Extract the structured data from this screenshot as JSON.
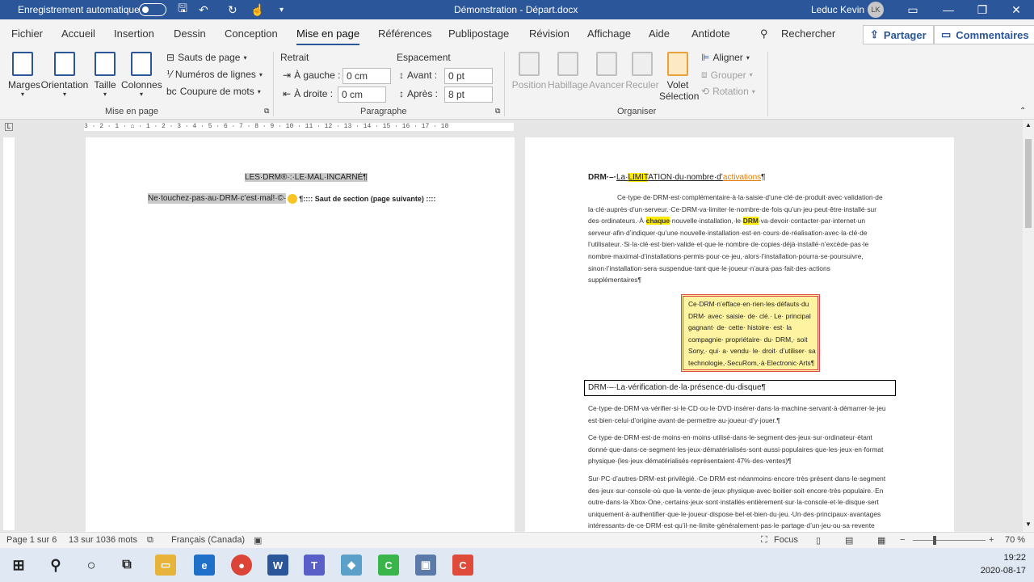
{
  "titlebar": {
    "autosave": "Enregistrement automatique",
    "doc_title": "Démonstration - Départ.docx",
    "user_name": "Leduc Kevin",
    "user_initials": "LK"
  },
  "tabs": [
    "Fichier",
    "Accueil",
    "Insertion",
    "Dessin",
    "Conception",
    "Mise en page",
    "Références",
    "Publipostage",
    "Révision",
    "Affichage",
    "Aide",
    "Antidote"
  ],
  "active_tab": "Mise en page",
  "search_label": "Rechercher",
  "share_label": "Partager",
  "comments_label": "Commentaires",
  "ribbon": {
    "margins": "Marges",
    "orientation": "Orientation",
    "size": "Taille",
    "columns": "Colonnes",
    "breaks": "Sauts de page",
    "line_numbers": "Numéros de lignes",
    "hyphenation": "Coupure de mots",
    "group_page_setup": "Mise en page",
    "indent_title": "Retrait",
    "left_label": "À gauche :",
    "left_value": "0 cm",
    "right_label": "À droite :",
    "right_value": "0 cm",
    "spacing_title": "Espacement",
    "before_label": "Avant :",
    "before_value": "0 pt",
    "after_label": "Après :",
    "after_value": "8 pt",
    "group_paragraph": "Paragraphe",
    "position": "Position",
    "wrap": "Habillage",
    "forward": "Avancer",
    "backward": "Reculer",
    "selection_pane_1": "Volet",
    "selection_pane_2": "Sélection",
    "align": "Aligner",
    "group": "Grouper",
    "rotate": "Rotation",
    "group_arrange": "Organiser"
  },
  "ruler_text": "3 · 2 · 1 · ⌂ · 1 · 2 · 3 · 4 · 5 · 6 · 7 · 8 · 9 · 10 · 11 · 12 · 13 · 14 · 15 · 16 · 17 · 18",
  "page1": {
    "title": "LES·DRM®·:·LE·MAL·INCARNÉ¶",
    "line2": "Ne·touchez·pas·au·DRM·c’est·mal!·©·",
    "section_break": "¶:::: Saut de section (page suivante) ::::"
  },
  "page2": {
    "heading_prefix": "DRM·–·",
    "heading_la": "La·",
    "heading_limit": "LIMIT",
    "heading_mid": "ATION·du·nombre·d’",
    "heading_activations": "activations",
    "heading_end": "¶",
    "para1": [
      "Ce·type·de·DRM·est·complémentaire·à·la·saisie·d’une·clé·de·produit·avec·validation·de",
      "la·clé·auprès·d’un·serveur.·Ce·DRM·va·limiter·le·nombre·de·fois·qu’un·jeu·peut·être·installé·sur",
      "serveur·afin·d’indiquer·qu’une·nouvelle·installation·est·en·cours·de·réalisation·avec·la·clé·de",
      "l’utilisateur.·Si·la·clé·est·bien·valide·et·que·le·nombre·de·copies·déjà·installé·n’excède·pas·le",
      "nombre·maximal·d’installations·permis·pour·ce·jeu,·alors·l’installation·pourra·se·poursuivre,",
      "sinon·l’installation·sera·suspendue·tant·que·le·joueur·n’aura·pas·fait·des·actions",
      "supplémentaires¶"
    ],
    "para1_line3_a": "des·ordinateurs.·À·",
    "para1_line3_b": "chaque",
    "para1_line3_c": "·nouvelle·installation,·le·",
    "para1_line3_d": "DRM",
    "para1_line3_e": "·va·devoir·contacter·par·internet·un",
    "sidebar": [
      "Ce·DRM·n’efface·en·rien·les·défauts·du",
      "DRM·  avec·  saisie·  de·  clé.·  Le·  principal",
      "gagnant·  de·  cette·  histoire·  est·  la",
      "compagnie·  propriétaire·  du·  DRM,·  soit",
      "Sony,·  qui·  a·  vendu·  le·  droit·  d’utiliser·  sa",
      "technologie,·SecuRom,·à·Electronic·Arts¶"
    ],
    "heading2": "DRM·–·La·vérification·de·la·présence·du·disque¶",
    "para2": [
      "Ce·type·de·DRM·va·vérifier·si·le·CD·ou·le·DVD·insérer·dans·la·machine·servant·à·démarrer·le·jeu",
      "est·bien·celui·d’origine·avant·de·permettre·au·joueur·d’y·jouer.¶"
    ],
    "para3": [
      "Ce·type·de·DRM·est·de·moins·en·moins·utilisé·dans·le·segment·des·jeux·sur·ordinateur·étant",
      "donné·que·dans·ce·segment·les·jeux·dématérialisés·sont·aussi·populaires·que·les·jeux·en·format",
      "physique·(les·jeux·dématérialisés·représentaient·47%·des·ventes)¶"
    ],
    "para4": [
      "Sur·PC·d’autres·DRM·est·privilégié.·Ce·DRM·est·néanmoins·encore·très·présent·dans·le·segment",
      "des·jeux·sur·console·où·que·la·vente·de·jeux·physique·avec·boitier·soit·encore·très·populaire.·En",
      "outre·dans·la·Xbox·One,·certains·jeux·sont·installés·entièrement·sur·la·console·et·le·disque·sert",
      "uniquement·à·authentifier·que·le·joueur·dispose·bel·et·bien·du·jeu.·Un·des·principaux·avantages",
      "intéressants·de·ce·DRM·est·qu’il·ne·limite·généralement·pas·le·partage·d’un·jeu·ou·sa·revente"
    ]
  },
  "status": {
    "page": "Page 1 sur 6",
    "words": "13 sur 1036 mots",
    "language": "Français (Canada)",
    "focus": "Focus",
    "zoom_minus": "−",
    "zoom_plus": "+",
    "zoom": "70 %"
  },
  "clock": {
    "time": "19:22",
    "date": "2020-08-17"
  },
  "colors": {
    "accent": "#2b579a",
    "highlight": "#ffeb00",
    "orange": "#e07b00"
  }
}
